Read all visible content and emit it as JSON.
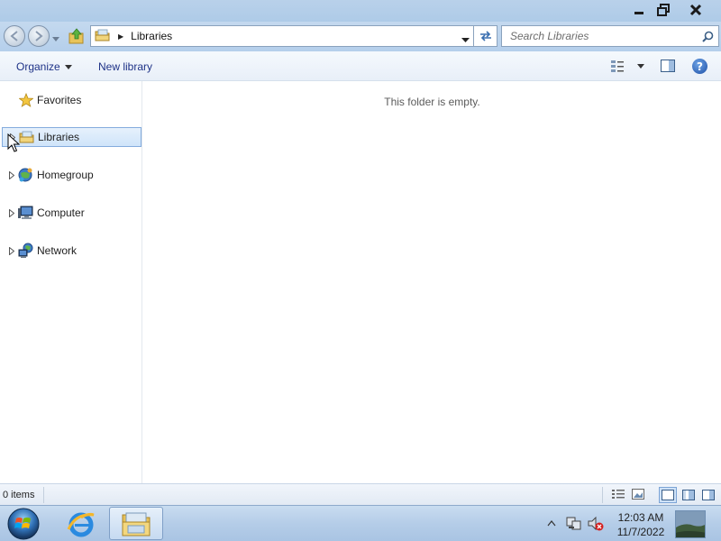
{
  "window": {
    "controls": {
      "minimize": "minimize",
      "maximize": "maximize",
      "close": "close"
    }
  },
  "address_bar": {
    "crumb": "Libraries"
  },
  "search": {
    "placeholder": "Search Libraries"
  },
  "command_bar": {
    "organize_label": "Organize",
    "new_library_label": "New library",
    "help_label": "?"
  },
  "nav_pane": {
    "items": [
      {
        "label": "Favorites",
        "icon": "star-icon",
        "expandable": false,
        "selected": false
      },
      {
        "label": "Libraries",
        "icon": "libraries-icon",
        "expandable": true,
        "selected": true
      },
      {
        "label": "Homegroup",
        "icon": "homegroup-icon",
        "expandable": true,
        "selected": false
      },
      {
        "label": "Computer",
        "icon": "computer-icon",
        "expandable": true,
        "selected": false
      },
      {
        "label": "Network",
        "icon": "network-icon",
        "expandable": true,
        "selected": false
      }
    ]
  },
  "content": {
    "empty_message": "This folder is empty."
  },
  "status_bar": {
    "item_count": "0 items"
  },
  "taskbar": {
    "pinned": [
      {
        "name": "internet-explorer",
        "icon": "ie-icon"
      },
      {
        "name": "windows-explorer",
        "icon": "explorer-folder-icon",
        "active": true
      }
    ],
    "clock": {
      "time": "12:03 AM",
      "date": "11/7/2022"
    }
  },
  "colors": {
    "titlebar": "#b9d1ea",
    "selection_bg": "#cfe4fa",
    "selection_border": "#84acdd",
    "command_text": "#1e3287"
  }
}
